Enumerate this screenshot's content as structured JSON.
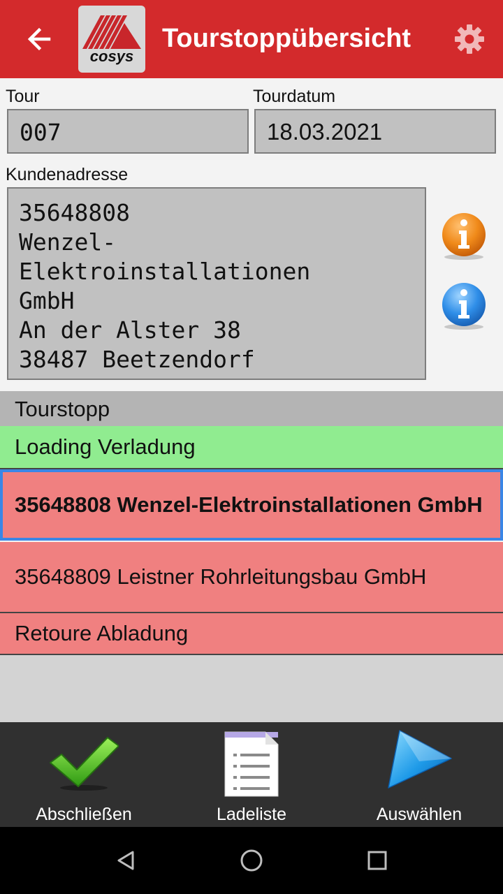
{
  "header": {
    "title": "Tourstoppübersicht",
    "logo_text": "cosys",
    "back_icon": "arrow-left-icon",
    "settings_icon": "gear-icon",
    "bar_color": "#d32a2c"
  },
  "form": {
    "tour_label": "Tour",
    "tour_value": "007",
    "date_label": "Tourdatum",
    "date_value": "18.03.2021",
    "address_label": "Kundenadresse",
    "address_lines": [
      "35648808",
      "Wenzel-",
      "Elektroinstallationen",
      "GmbH",
      "An der Alster 38",
      "38487 Beetzendorf"
    ]
  },
  "info_buttons": [
    {
      "icon": "info-orange-icon",
      "color": "#f08a1a"
    },
    {
      "icon": "info-blue-icon",
      "color": "#2f8ee8"
    }
  ],
  "list": {
    "header": "Tourstopp",
    "rows": [
      {
        "text": "Loading Verladung",
        "color": "#90ec90",
        "selected": false
      },
      {
        "text": "35648808 Wenzel-Elektroinstallationen GmbH",
        "color": "#f08080",
        "selected": true
      },
      {
        "text": "35648809 Leistner Rohrleitungsbau GmbH",
        "color": "#f08080",
        "selected": false
      },
      {
        "text": "Retoure Abladung",
        "color": "#f08080",
        "selected": false
      }
    ]
  },
  "toolbar": {
    "finish_label": "Abschließen",
    "finish_icon": "checkmark-icon",
    "loadlist_label": "Ladeliste",
    "loadlist_icon": "document-list-icon",
    "select_label": "Auswählen",
    "select_icon": "play-arrow-icon"
  },
  "navbar": {
    "back_icon": "nav-back-icon",
    "home_icon": "nav-home-icon",
    "recents_icon": "nav-recents-icon"
  }
}
